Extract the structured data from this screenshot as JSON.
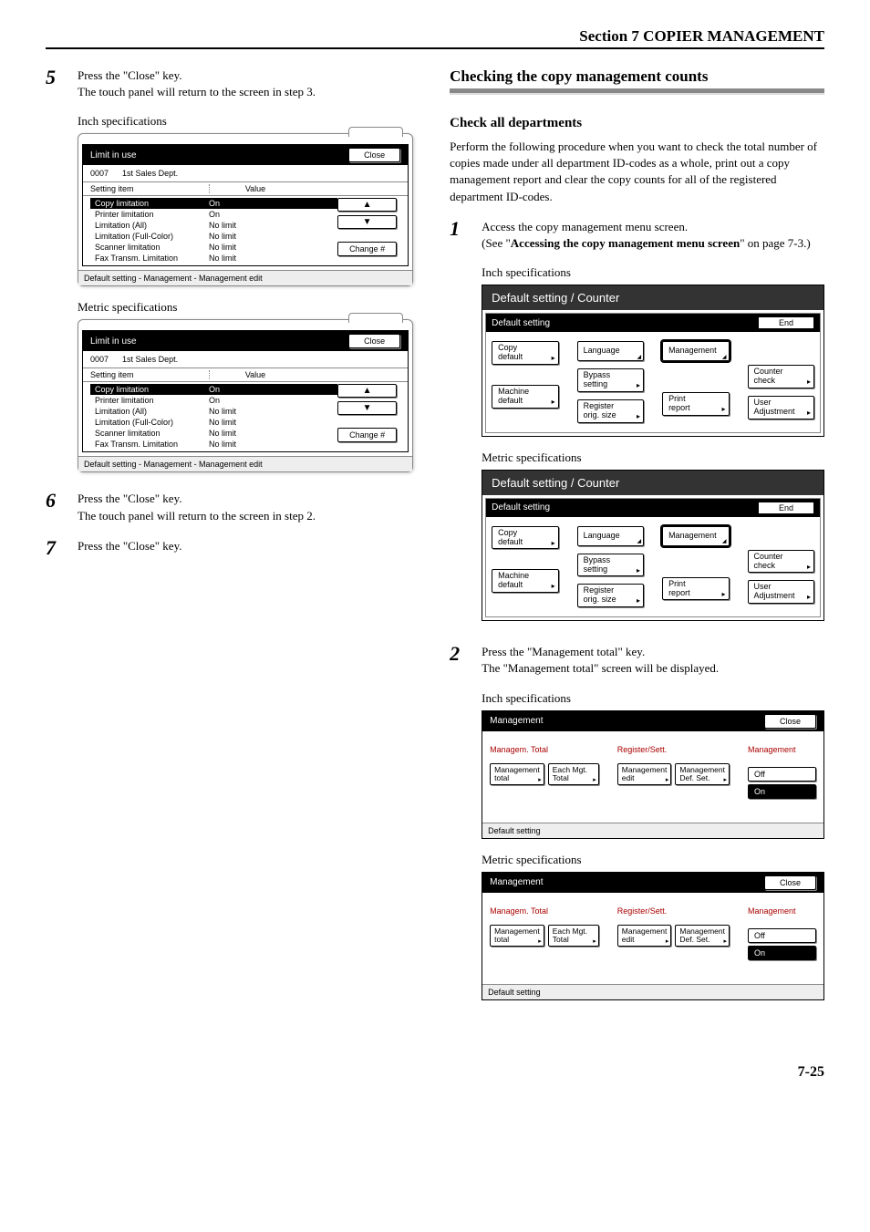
{
  "header": "Section 7  COPIER MANAGEMENT",
  "page_number": "7-25",
  "left": {
    "step5": {
      "num": "5",
      "line1": "Press the \"Close\" key.",
      "line2": "The touch panel will return to the screen in step 3."
    },
    "step6": {
      "num": "6",
      "line1": "Press the \"Close\" key.",
      "line2": "The touch panel will return to the screen in step 2."
    },
    "step7": {
      "num": "7",
      "line1": "Press the \"Close\" key."
    },
    "inch_label": "Inch specifications",
    "metric_label": "Metric specifications",
    "limit_screen": {
      "title": "Limit in use",
      "close": "Close",
      "dept_code": "0007",
      "dept_name": "1st Sales Dept.",
      "col_item": "Setting item",
      "col_value": "Value",
      "rows": [
        {
          "item": "Copy limitation",
          "value": "On",
          "hl": true
        },
        {
          "item": "Printer limitation",
          "value": "On"
        },
        {
          "item": "Limitation (All)",
          "value": "No limit"
        },
        {
          "item": "Limitation (Full-Color)",
          "value": "No limit"
        },
        {
          "item": "Scanner limitation",
          "value": "No limit"
        },
        {
          "item": "Fax Transm. Limitation",
          "value": "No limit"
        }
      ],
      "change": "Change #",
      "footer": "Default setting - Management - Management edit"
    }
  },
  "right": {
    "title": "Checking the copy management counts",
    "subtitle": "Check all departments",
    "intro": "Perform the following procedure when you want to check the total number of copies made under all department ID-codes as a whole, print out a copy management report and clear the copy counts for all of the registered department ID-codes.",
    "step1": {
      "num": "1",
      "line1": "Access the copy management menu screen.",
      "line2a": "(See \"",
      "line2b": "Accessing the copy management menu screen",
      "line2c": "\" on page 7-3.)"
    },
    "step2": {
      "num": "2",
      "line1": "Press the \"Management total\" key.",
      "line2": "The \"Management total\" screen will be displayed."
    },
    "inch_label": "Inch specifications",
    "metric_label": "Metric specifications",
    "default_screen": {
      "head": "Default setting / Counter",
      "tab": "Default setting",
      "end": "End",
      "btns": {
        "copy_default": "Copy\ndefault",
        "machine_default": "Machine\ndefault",
        "language": "Language",
        "bypass": "Bypass\nsetting",
        "register": "Register\norig. size",
        "management": "Management",
        "print_report": "Print\nreport",
        "counter_check": "Counter\ncheck",
        "user_adjust": "User\nAdjustment"
      }
    },
    "mgmt_screen": {
      "title": "Management",
      "close": "Close",
      "col1_label": "Managem. Total",
      "col2_label": "Register/Sett.",
      "col3_label": "Management",
      "btn_mgmt_total": "Management\ntotal",
      "btn_each_total": "Each Mgt.\nTotal",
      "btn_mgmt_edit": "Management\nedit",
      "btn_mgmt_def": "Management\nDef. Set.",
      "off": "Off",
      "on": "On",
      "footer": "Default setting"
    }
  }
}
